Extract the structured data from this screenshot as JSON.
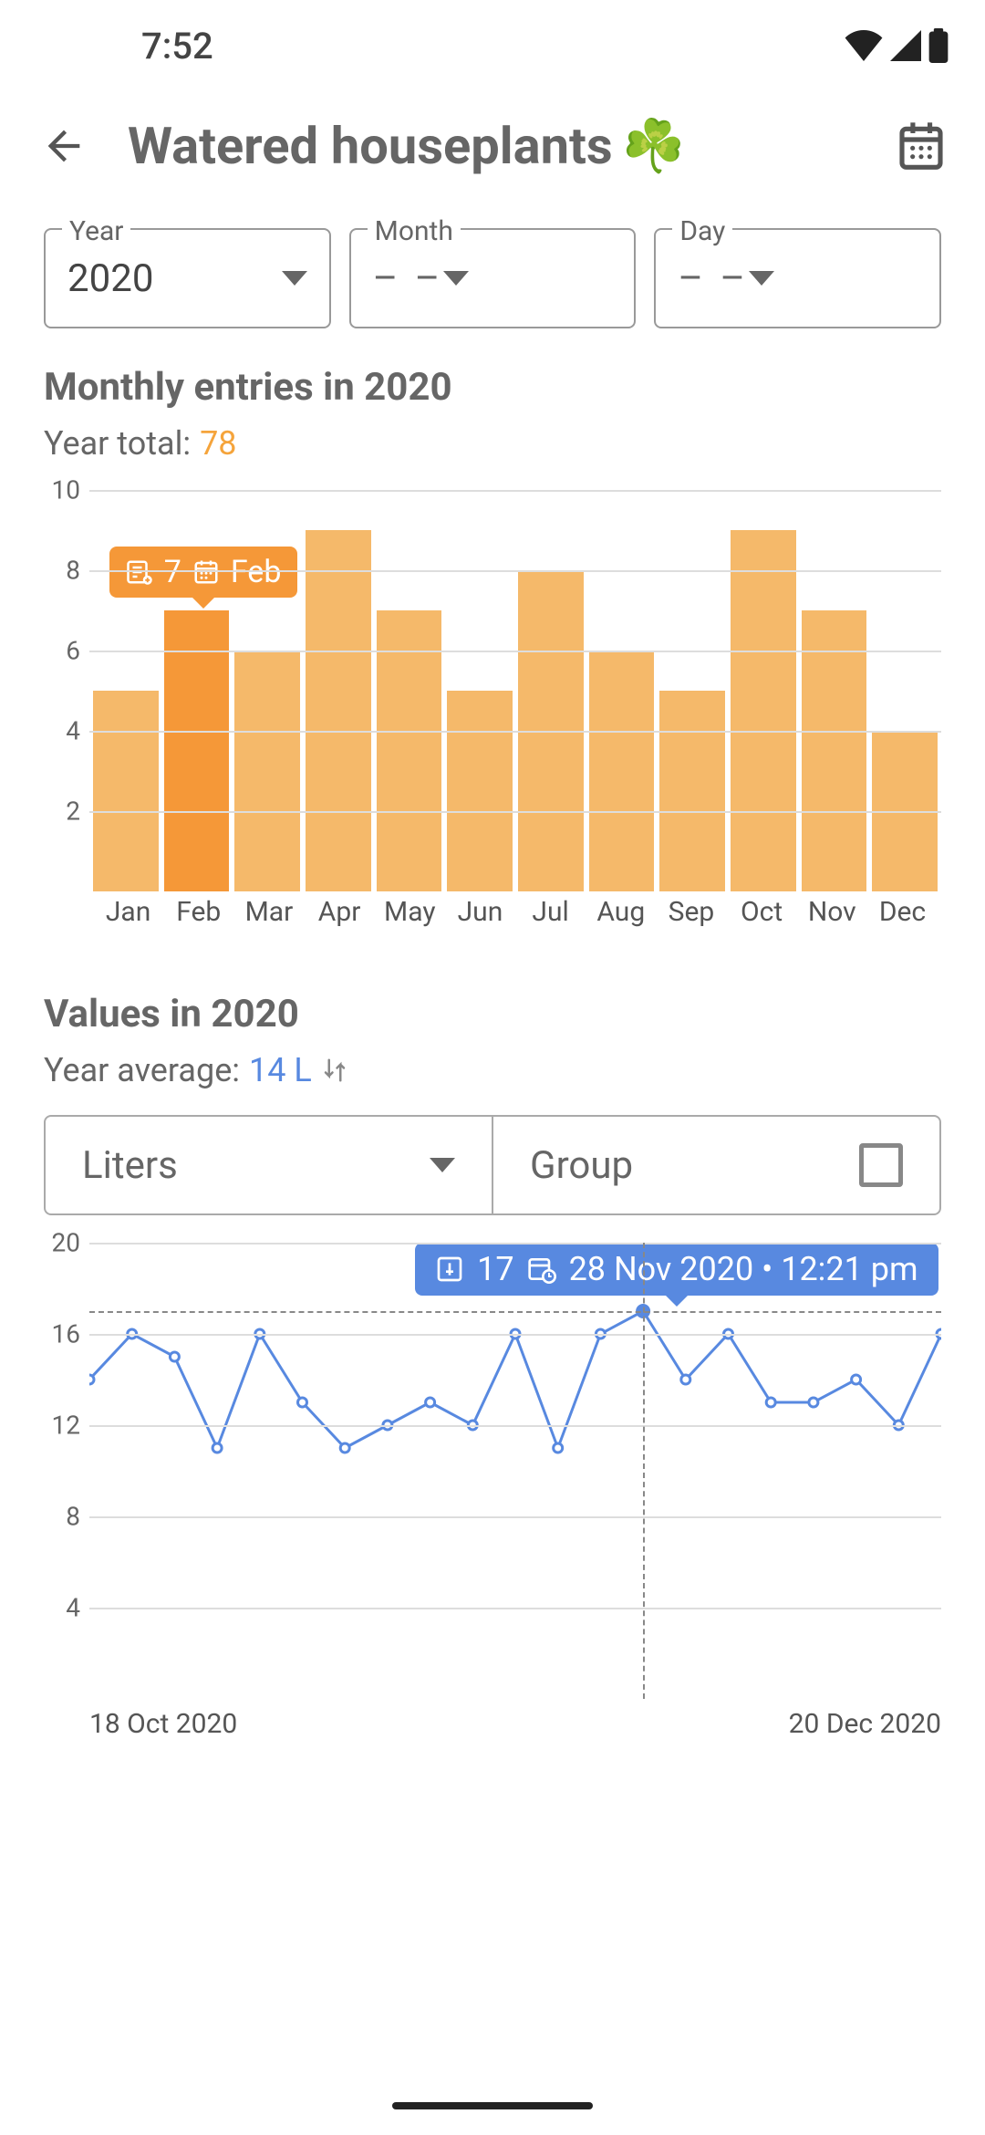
{
  "status": {
    "time": "7:52"
  },
  "header": {
    "title": "Watered houseplants",
    "emoji": "☘️"
  },
  "filters": {
    "year": {
      "label": "Year",
      "value": "2020"
    },
    "month": {
      "label": "Month",
      "value": "– –"
    },
    "day": {
      "label": "Day",
      "value": "– –"
    }
  },
  "section1": {
    "title": "Monthly entries in 2020",
    "sub_label": "Year total: ",
    "sub_value": "78"
  },
  "bar_tooltip": {
    "count": "7",
    "label": "Feb"
  },
  "section2": {
    "title": "Values in 2020",
    "sub_label": "Year average: ",
    "sub_value": "14 L"
  },
  "values_controls": {
    "metric": "Liters",
    "group": "Group"
  },
  "line_tooltip": {
    "value": "17",
    "label": "28 Nov 2020 • 12:21 pm"
  },
  "line_x": {
    "start": "18 Oct 2020",
    "end": "20 Dec 2020"
  },
  "chart_data": [
    {
      "type": "bar",
      "title": "Monthly entries in 2020",
      "categories": [
        "Jan",
        "Feb",
        "Mar",
        "Apr",
        "May",
        "Jun",
        "Jul",
        "Aug",
        "Sep",
        "Oct",
        "Nov",
        "Dec"
      ],
      "values": [
        5,
        7,
        6,
        9,
        7,
        5,
        8,
        6,
        5,
        9,
        7,
        4
      ],
      "ylim": [
        0,
        10
      ],
      "yticks": [
        2,
        4,
        6,
        8,
        10
      ],
      "selected_index": 1,
      "tooltip": {
        "category": "Feb",
        "value": 7
      }
    },
    {
      "type": "line",
      "title": "Values in 2020",
      "xlabel_start": "18 Oct 2020",
      "xlabel_end": "20 Dec 2020",
      "ylim": [
        0,
        20
      ],
      "yticks": [
        4,
        8,
        12,
        16,
        20
      ],
      "unit": "L",
      "series": [
        {
          "name": "Liters",
          "values": [
            14,
            16,
            15,
            11,
            16,
            13,
            11,
            12,
            13,
            12,
            16,
            11,
            16,
            17,
            14,
            16,
            13,
            13,
            14,
            12,
            16
          ]
        }
      ],
      "selected_point": {
        "index": 13,
        "value": 17,
        "label": "28 Nov 2020 • 12:21 pm"
      }
    }
  ]
}
